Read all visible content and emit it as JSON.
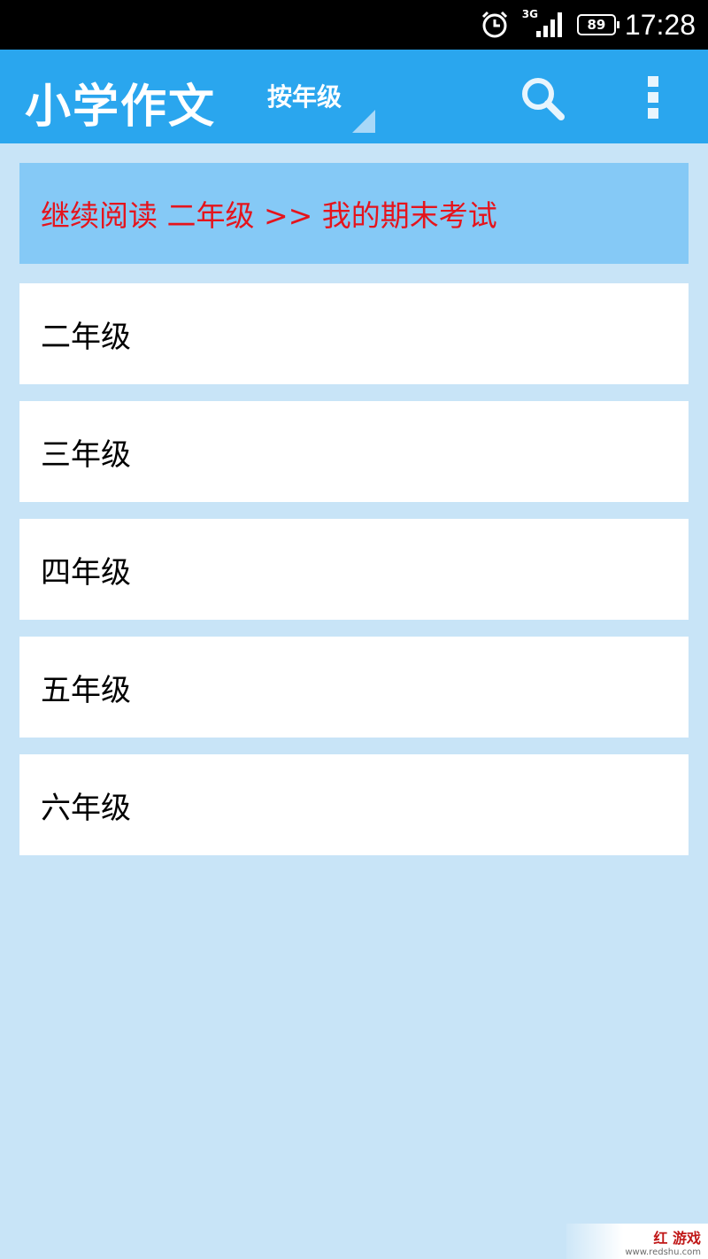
{
  "status_bar": {
    "network_type": "3G",
    "battery": "89",
    "time": "17:28",
    "icons": [
      "alarm-icon",
      "signal-icon",
      "battery-icon"
    ]
  },
  "app_bar": {
    "logo_text": "小学作文",
    "spinner_label": "按年级",
    "icons": [
      "search-icon",
      "overflow-menu-icon"
    ],
    "color": "#2aa6ee"
  },
  "continue_reading": {
    "label": "继续阅读 二年级 >> 我的期末考试",
    "color": "#e5141c"
  },
  "grades": [
    {
      "label": "二年级"
    },
    {
      "label": "三年级"
    },
    {
      "label": "四年级"
    },
    {
      "label": "五年级"
    },
    {
      "label": "六年级"
    }
  ],
  "watermark": {
    "main": "红 游戏",
    "sub": "www.redshu.com"
  }
}
